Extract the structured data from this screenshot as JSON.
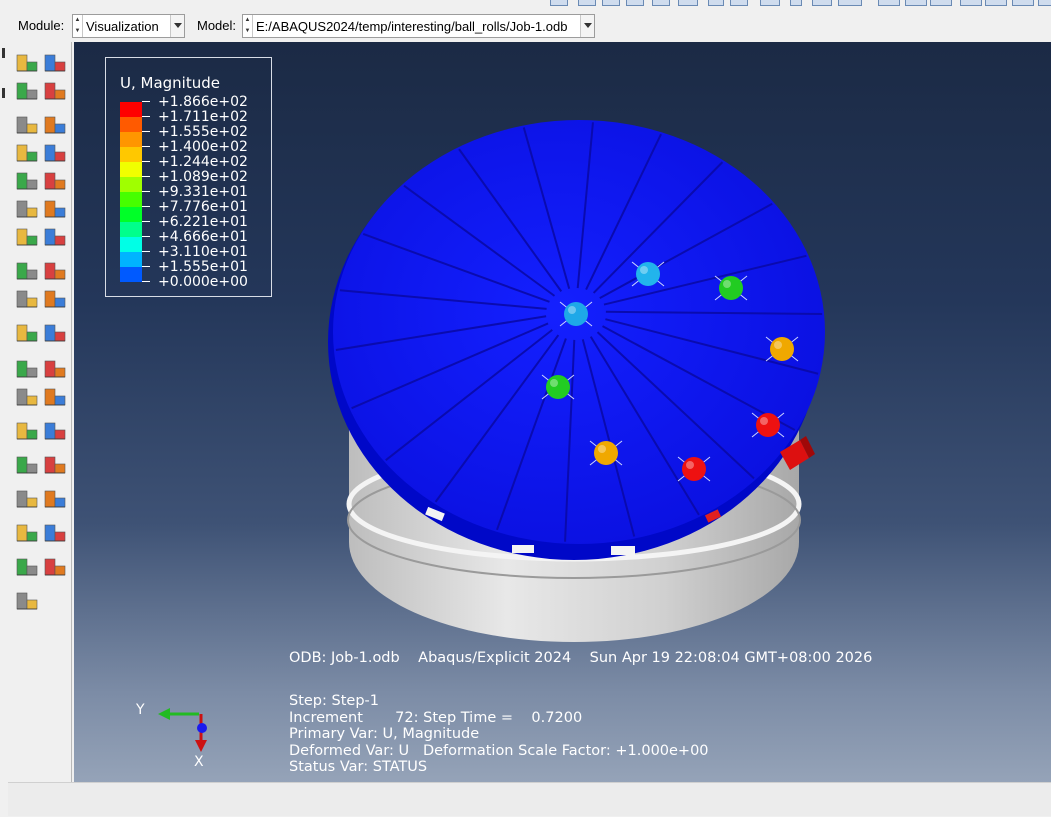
{
  "module": {
    "label": "Module:",
    "value": "Visualization"
  },
  "model": {
    "label": "Model:",
    "value": "E:/ABAQUS2024/temp/interesting/ball_rolls/Job-1.odb"
  },
  "legend": {
    "title": "U, Magnitude",
    "entries": [
      {
        "value": "+1.866e+02",
        "color": "#ff0000"
      },
      {
        "value": "+1.711e+02",
        "color": "#ff5a00"
      },
      {
        "value": "+1.555e+02",
        "color": "#ff9600"
      },
      {
        "value": "+1.400e+02",
        "color": "#ffc800"
      },
      {
        "value": "+1.244e+02",
        "color": "#f0ff00"
      },
      {
        "value": "+1.089e+02",
        "color": "#a0ff00"
      },
      {
        "value": "+9.331e+01",
        "color": "#46ff00"
      },
      {
        "value": "+7.776e+01",
        "color": "#00ff28"
      },
      {
        "value": "+6.221e+01",
        "color": "#00ff8c"
      },
      {
        "value": "+4.666e+01",
        "color": "#00ffe6"
      },
      {
        "value": "+3.110e+01",
        "color": "#00b4ff"
      },
      {
        "value": "+1.555e+01",
        "color": "#005aff"
      },
      {
        "value": "+0.000e+00",
        "color": "#0000ff"
      }
    ]
  },
  "info": {
    "odb_line": "ODB: Job-1.odb    Abaqus/Explicit 2024    Sun Apr 19 22:08:04 GMT+08:00 2026",
    "step": "Step: Step-1",
    "increment": "Increment       72: Step Time =    0.7200",
    "primary_var": "Primary Var: U, Magnitude",
    "deformed_var": "Deformed Var: U   Deformation Scale Factor: +1.000e+00",
    "status_var": "Status Var: STATUS"
  },
  "triad": {
    "y_label": "Y",
    "x_label": "X"
  },
  "colors": {
    "disk": "#0c12f0",
    "cylinder": "#d4d4d4",
    "viewport_top": "#1b2a45",
    "viewport_bottom": "#95a3b8"
  },
  "balls": [
    {
      "name": "ball-center",
      "color": "#1ea8e8"
    },
    {
      "name": "ball-cyan",
      "color": "#22b4ec"
    },
    {
      "name": "ball-green-1",
      "color": "#22cc22"
    },
    {
      "name": "ball-orange-1",
      "color": "#f0a800"
    },
    {
      "name": "ball-green-2",
      "color": "#22cc22"
    },
    {
      "name": "ball-red-1",
      "color": "#ee1111"
    },
    {
      "name": "ball-orange-2",
      "color": "#f0a800"
    },
    {
      "name": "ball-red-2",
      "color": "#ee1111"
    }
  ],
  "toolbox_icons": [
    "common-plot-options-icon",
    "contour-options-icon",
    "element-labels-icon",
    "layer-icon",
    "plot-undeformed-icon",
    "plot-deformed-icon",
    "plot-contours-icon",
    "contour-options-2-icon",
    "plot-symbols-icon",
    "symbol-options-icon",
    "plot-material-orientations-icon",
    "orientation-options-icon",
    "allow-multiple-plot-states-icon",
    "superimpose-options-icon",
    "animate-scale-factor-icon",
    "animate-time-history-icon",
    "animation-options-icon",
    "frame-list-icon",
    "plot-axes-icon",
    "axes-manager-icon",
    "create-xy-data-icon",
    "xy-data-manager-icon",
    "create-path-icon",
    "plot-xy-data-icon",
    "create-display-group-icon",
    "display-group-manager-icon",
    "view-cut-icon",
    "view-cut-manager-icon",
    "free-body-cut-icon",
    "free-body-manager-icon",
    "stream-plot-icon",
    "stream-manager-icon",
    "coordinate-system-icon",
    "coordinate-manager-icon",
    "query-tool-icon"
  ]
}
